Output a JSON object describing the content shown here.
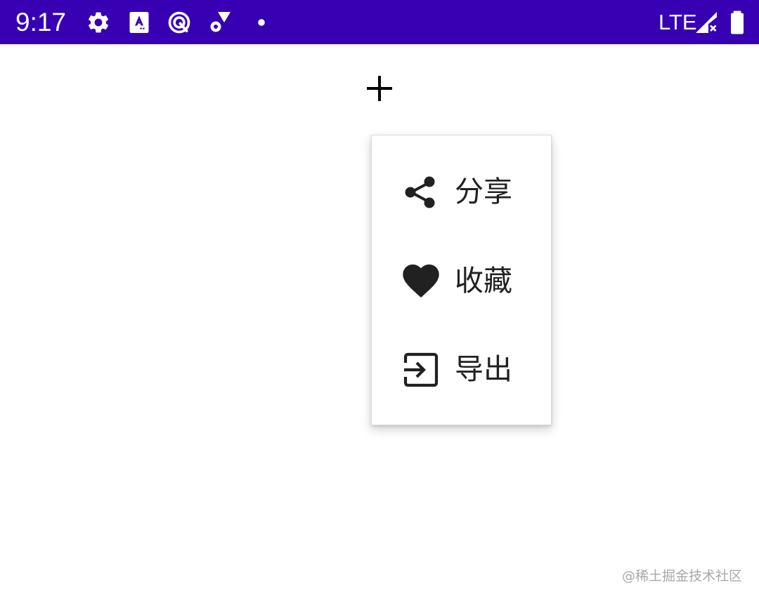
{
  "status_bar": {
    "time": "9:17",
    "network": "LTE",
    "background_color": "#3700b3",
    "icons": [
      "settings-icon",
      "keyboard-a-icon",
      "data-saver-icon",
      "wifi-gear-icon",
      "notification-dot-icon",
      "signal-icon",
      "battery-icon"
    ]
  },
  "toolbar": {
    "add_icon": "plus-icon"
  },
  "popup_menu": {
    "items": [
      {
        "label": "分享",
        "icon": "share-icon"
      },
      {
        "label": "收藏",
        "icon": "heart-icon"
      },
      {
        "label": "导出",
        "icon": "exit-icon"
      }
    ]
  },
  "watermark": "@稀土掘金技术社区"
}
